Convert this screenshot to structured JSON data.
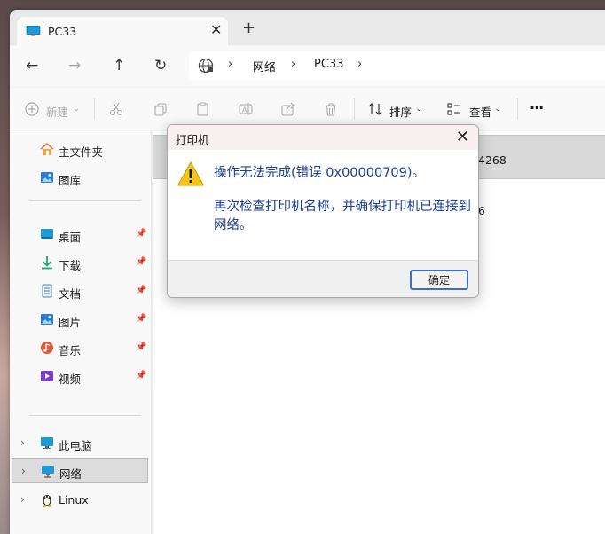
{
  "tab": {
    "title": "PC33",
    "close": "✕",
    "new_tab": "+"
  },
  "nav": {
    "back": "←",
    "forward": "→",
    "up": "↑",
    "refresh": "↻"
  },
  "address": {
    "crumbs": [
      "网络",
      "PC33"
    ],
    "sep": "›"
  },
  "toolbar": {
    "new_label": "新建",
    "sort_label": "排序",
    "view_label": "查看",
    "more": "···",
    "dropdown": "⌄"
  },
  "sidebar": {
    "items": [
      {
        "label": "主文件夹"
      },
      {
        "label": "图库"
      },
      {
        "label": "桌面"
      },
      {
        "label": "下载"
      },
      {
        "label": "文档"
      },
      {
        "label": "图片"
      },
      {
        "label": "音乐"
      },
      {
        "label": "视频"
      },
      {
        "label": "此电脑"
      },
      {
        "label": "网络"
      },
      {
        "label": "Linux"
      }
    ],
    "pin": "📌",
    "chevron": "›"
  },
  "content": {
    "row1_fragment": "4268",
    "row2_fragment": "6"
  },
  "dialog": {
    "title": "打印机",
    "close": "✕",
    "message_main": "操作无法完成(错误 0x00000709)。",
    "message_sub": "再次检查打印机名称，并确保打印机已连接到网络。",
    "ok_label": "确定"
  },
  "colors": {
    "accent": "#3a6fc4",
    "dialog_text": "#1c3e94",
    "warning": "#f5c518"
  }
}
